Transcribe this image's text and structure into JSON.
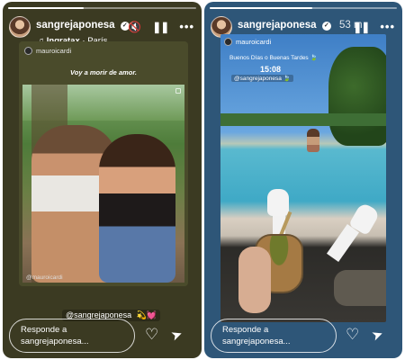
{
  "left_story": {
    "progress": 0.4,
    "username": "sangrejaponesa",
    "music_artist": "Inqratax",
    "music_title": "París",
    "card": {
      "shared_user": "mauroicardi",
      "caption": "Voy a morir de amor.",
      "handle": "@mauroicardi"
    },
    "mention": "@sangrejaponesa",
    "mention_emoji": "💫💓",
    "reply_placeholder": "Responde a sangrejaponesa...",
    "icons": {
      "mute": "mute-icon",
      "pause": "pause-icon",
      "more": "more-icon",
      "like": "heart-icon",
      "send": "send-icon"
    }
  },
  "right_story": {
    "progress": 0.55,
    "username": "sangrejaponesa",
    "time_ago": "53 m",
    "sticker": {
      "user": "mauroicardi",
      "text": "Buenos Días o Buenas Tardes 🍃",
      "time": "15:08",
      "tag": "@sangrejaponesa 🍃"
    },
    "reply_placeholder": "Responde a sangrejaponesa...",
    "icons": {
      "pause": "pause-icon",
      "more": "more-icon",
      "like": "heart-icon",
      "send": "send-icon"
    }
  },
  "glyphs": {
    "verified": "✓",
    "music": "♫",
    "mute": "🔇",
    "pause": "❚❚",
    "more": "•••",
    "heart": "♡",
    "send": "➤"
  }
}
